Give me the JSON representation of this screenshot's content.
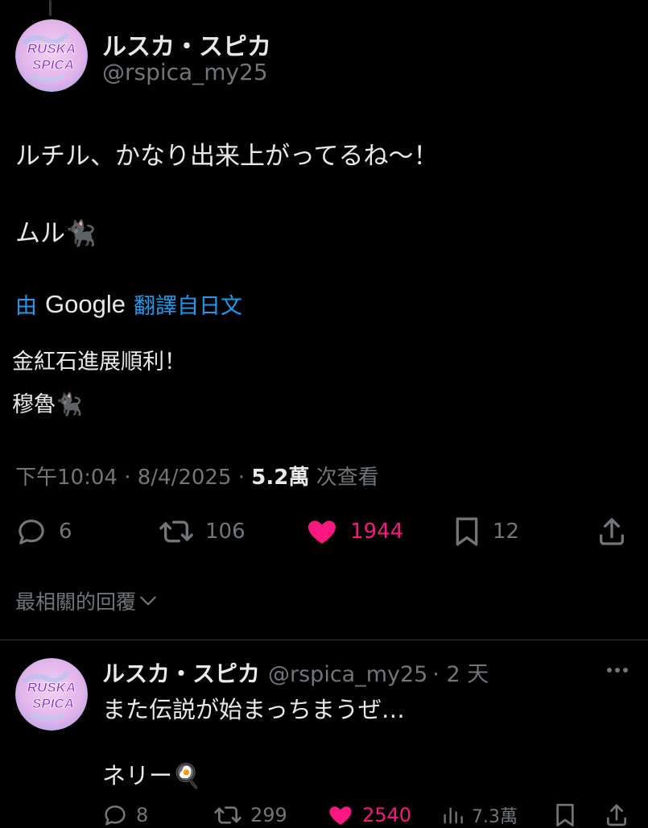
{
  "tweet": {
    "display_name": "ルスカ・スピカ",
    "handle": "@rspica_my25",
    "avatar_text_line1": "RUSKA",
    "avatar_text_line2": "SPICA",
    "text_line1": "ルチル、かなり出来上がってるね〜！",
    "text_line2": "ムル🐈‍⬛",
    "translation_prefix": "由",
    "translation_brand": "Google",
    "translation_suffix": "翻譯自日文",
    "translated_line1": "金紅石進展順利！",
    "translated_line2": "穆魯🐈‍⬛",
    "timestamp": "下午10:04 · 8/4/2025 · ",
    "views_count": "5.2萬",
    "views_label": " 次查看",
    "replies": "6",
    "reposts": "106",
    "likes": "1944",
    "bookmarks": "12"
  },
  "replies_section": {
    "sort_label": "最相關的回覆"
  },
  "reply": {
    "display_name": "ルスカ・スピカ",
    "handle": "@rspica_my25",
    "time": "· 2 天",
    "avatar_text_line1": "RUSKA",
    "avatar_text_line2": "SPICA",
    "text_line1": "また伝説が始まっちまうぜ…",
    "text_line2": "ネリー🍳",
    "replies": "8",
    "reposts": "299",
    "likes": "2540",
    "views": "7.3萬"
  },
  "colors": {
    "background": "#000000",
    "text": "#e7e9ea",
    "muted": "#71767b",
    "link": "#1d9bf0",
    "like": "#f91880",
    "avatar_bg": "#e7b9ec",
    "avatar_text": "#8a2be2"
  },
  "icons": [
    "reply-icon",
    "repost-icon",
    "heart-icon",
    "bookmark-icon",
    "share-icon",
    "chevron-down-icon",
    "more-icon",
    "views-icon"
  ]
}
